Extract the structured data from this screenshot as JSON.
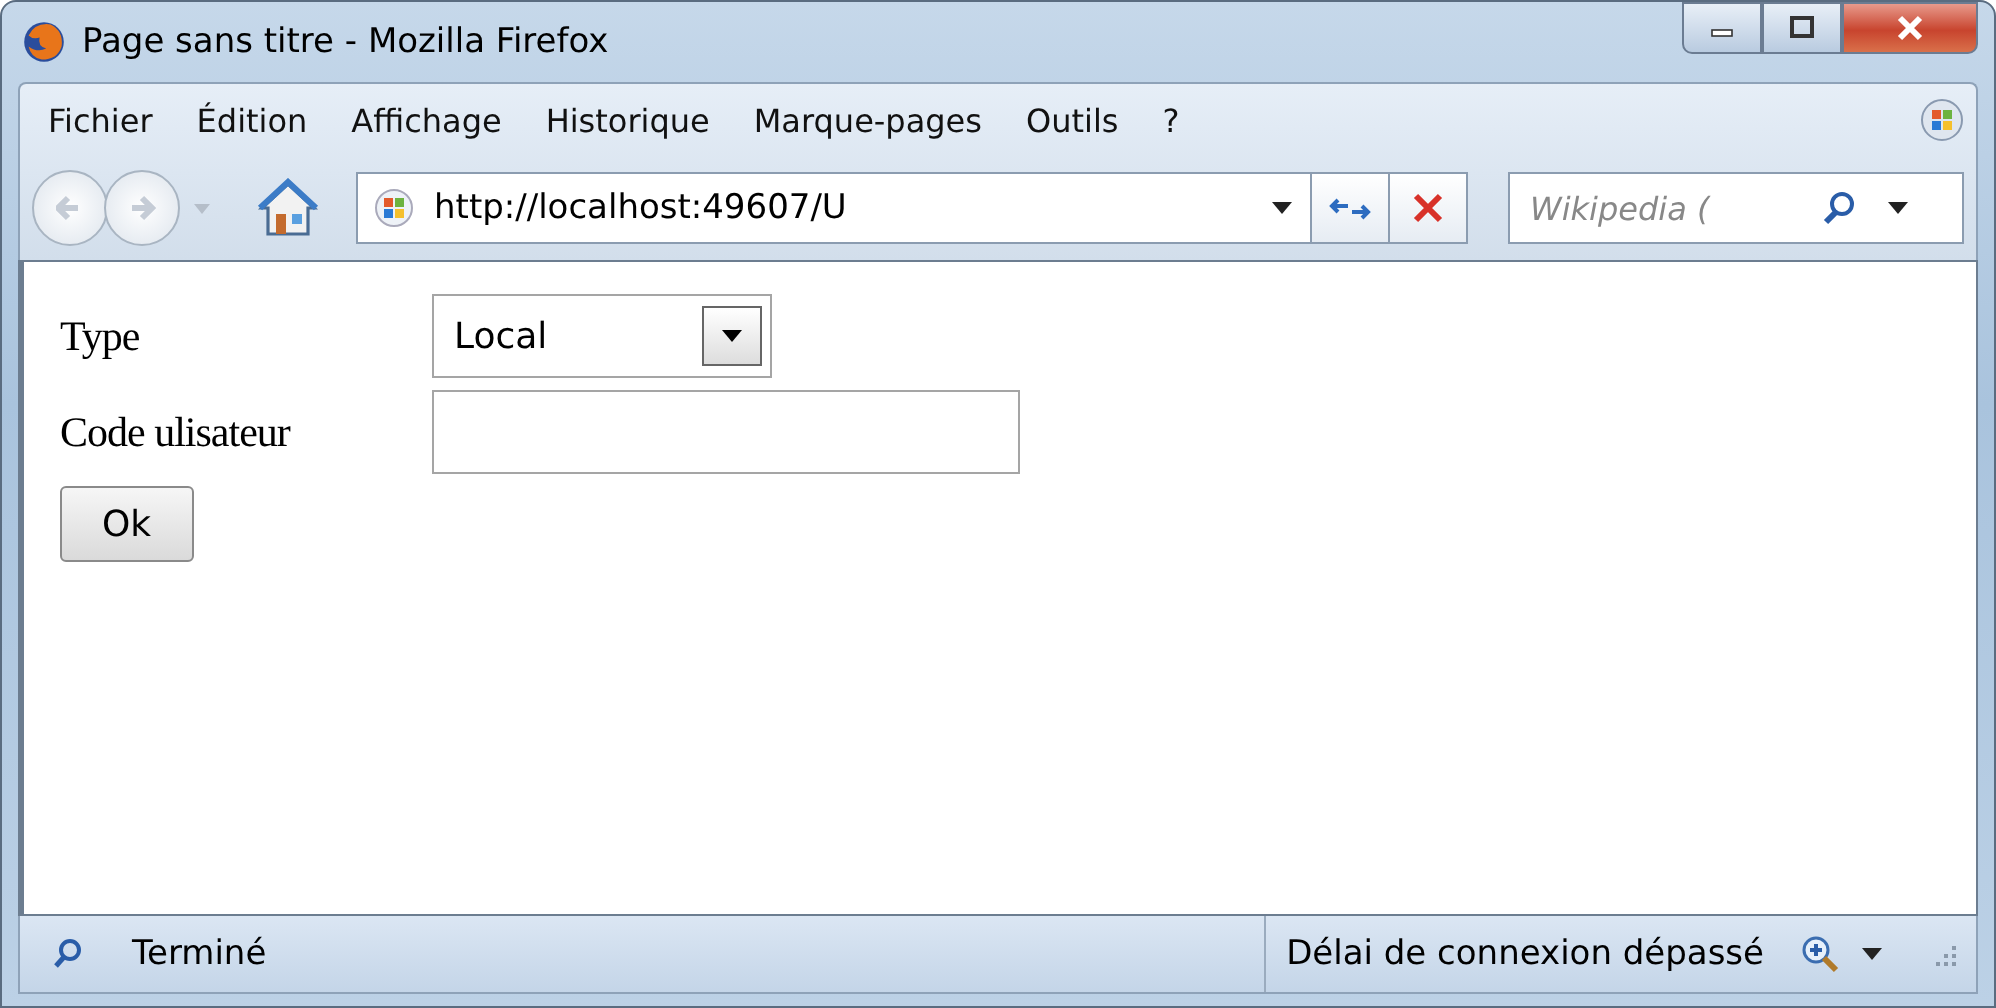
{
  "window": {
    "title": "Page sans titre - Mozilla Firefox"
  },
  "menu": [
    "Fichier",
    "Édition",
    "Affichage",
    "Historique",
    "Marque-pages",
    "Outils",
    "?"
  ],
  "address": {
    "value": "http://localhost:49607/U"
  },
  "search": {
    "placeholder": "Wikipedia ("
  },
  "form": {
    "type_label": "Type",
    "type_value": "Local",
    "code_label": "Code ulisateur",
    "button": "Ok"
  },
  "status_bar": {
    "left": "Terminé",
    "right": "Délai de connexion dépassé"
  }
}
